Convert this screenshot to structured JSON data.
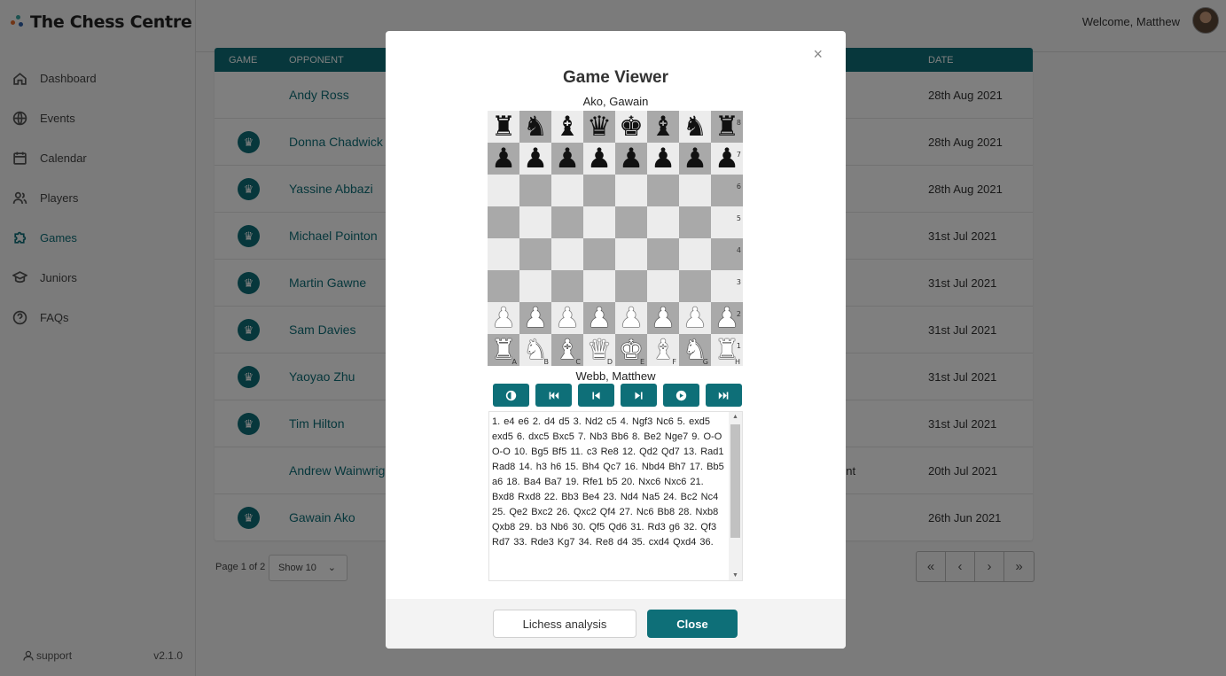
{
  "app": {
    "title": "The Chess Centre",
    "version": "v2.1.0",
    "support_label": "support"
  },
  "header": {
    "welcome": "Welcome, Matthew"
  },
  "nav": [
    {
      "label": "Dashboard",
      "icon": "home-icon"
    },
    {
      "label": "Events",
      "icon": "globe-icon"
    },
    {
      "label": "Calendar",
      "icon": "calendar-icon"
    },
    {
      "label": "Players",
      "icon": "users-icon"
    },
    {
      "label": "Games",
      "icon": "puzzle-icon",
      "active": true
    },
    {
      "label": "Juniors",
      "icon": "graduation-icon"
    },
    {
      "label": "FAQs",
      "icon": "question-icon"
    }
  ],
  "table": {
    "headers": {
      "game": "GAME",
      "opponent": "OPPONENT",
      "date": "DATE"
    },
    "rows": [
      {
        "opponent": "Andy Ross",
        "date": "28th Aug 2021",
        "has_game": false,
        "extra": ""
      },
      {
        "opponent": "Donna Chadwick",
        "date": "28th Aug 2021",
        "has_game": true,
        "extra": ""
      },
      {
        "opponent": "Yassine Abbazi",
        "date": "28th Aug 2021",
        "has_game": true,
        "extra": ""
      },
      {
        "opponent": "Michael Pointon",
        "date": "31st Jul 2021",
        "has_game": true,
        "extra": ""
      },
      {
        "opponent": "Martin Gawne",
        "date": "31st Jul 2021",
        "has_game": true,
        "extra": ""
      },
      {
        "opponent": "Sam Davies",
        "date": "31st Jul 2021",
        "has_game": true,
        "extra": ""
      },
      {
        "opponent": "Yaoyao Zhu",
        "date": "31st Jul 2021",
        "has_game": true,
        "extra": ""
      },
      {
        "opponent": "Tim Hilton",
        "date": "31st Jul 2021",
        "has_game": true,
        "extra": ""
      },
      {
        "opponent": "Andrew Wainwrig",
        "date": "20th Jul 2021",
        "has_game": false,
        "extra": "ent"
      },
      {
        "opponent": "Gawain Ako",
        "date": "26th Jun 2021",
        "has_game": true,
        "extra": ""
      }
    ]
  },
  "pagination": {
    "info": "Page 1 of 2",
    "show": "Show 10"
  },
  "modal": {
    "title": "Game Viewer",
    "black_player": "Ako, Gawain",
    "white_player": "Webb, Matthew",
    "close_symbol": "×",
    "board": {
      "ranks": [
        "8",
        "7",
        "6",
        "5",
        "4",
        "3",
        "2",
        "1"
      ],
      "files": [
        "A",
        "B",
        "C",
        "D",
        "E",
        "F",
        "G",
        "H"
      ],
      "position": [
        "rnbqkbnr",
        "pppppppp",
        "........",
        "........",
        "........",
        "........",
        "PPPPPPPP",
        "RNBQKBNR"
      ]
    },
    "controls": [
      "flip-icon",
      "first-icon",
      "prev-icon",
      "next-icon",
      "play-icon",
      "last-icon"
    ],
    "moves": "1.  e4  e6 2.  d4  d5 3.  Nd2  c5 4.  Ngf3  Nc6 5.  exd5  exd5 6.  dxc5  Bxc5 7.  Nb3  Bb6 8.  Be2  Nge7 9.  O-O  O-O 10.  Bg5  Bf5 11.  c3  Re8 12.  Qd2  Qd7 13.  Rad1  Rad8 14.  h3  h6 15.  Bh4  Qc7 16.  Nbd4  Bh7 17.  Bb5  a6 18.  Ba4  Ba7 19.  Rfe1  b5 20.  Nxc6  Nxc6 21.  Bxd8  Rxd8 22.  Bb3  Be4 23.  Nd4  Na5 24.  Bc2  Nc4 25.  Qe2  Bxc2 26.  Qxc2  Qf4 27.  Nc6  Bb8 28.  Nxb8  Qxb8 29.  b3  Nb6 30.  Qf5  Qd6 31.  Rd3  g6 32.  Qf3  Rd7 33.  Rde3  Kg7 34.  Re8  d4 35.  cxd4  Qxd4 36.",
    "lichess_label": "Lichess analysis",
    "close_label": "Close"
  },
  "colors": {
    "accent": "#0e6f78"
  }
}
